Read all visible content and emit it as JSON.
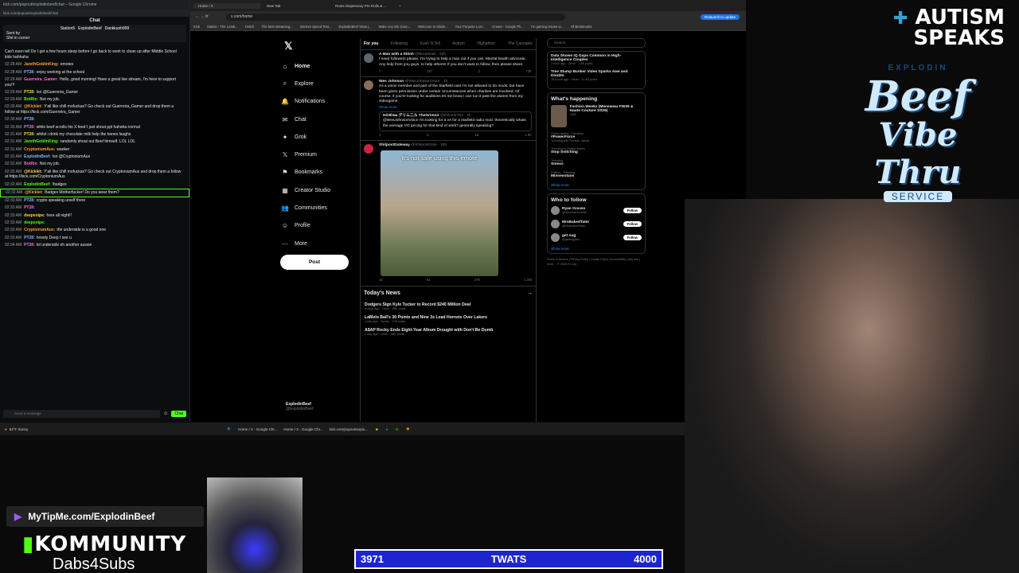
{
  "chat_window": {
    "title_bar": "kick.com/popout/explodinbeef/chat – Google Chrome",
    "url": "kick.com/popout/explodinbeef/chat",
    "chat_title": "Chat",
    "pinned": {
      "users": [
        "Station5",
        "ExplodinBeef",
        "Dankkush999"
      ],
      "sent_by": "Sent by",
      "text": "Shit in corner"
    },
    "messages": [
      {
        "time": "",
        "user": "",
        "text": "Can't even tell Do I get a few hours sleep before I go back to work to clean up after Middle School kids hahhaha"
      },
      {
        "time": "02:28 AM",
        "user": "JarethGoblinKing:",
        "text": "emotes"
      },
      {
        "time": "02:28 AM",
        "user": "PT28:",
        "text": "enjoy working at the school"
      },
      {
        "time": "02:29 AM",
        "user": "Guerreira_Gamer:",
        "text": "Hello, good morning! Have a great live stream, I'm here to support you!!!"
      },
      {
        "time": "02:29 AM",
        "user": "PT28:",
        "text": "Iso @Guerreira_Gamer"
      },
      {
        "time": "02:29 AM",
        "user": "BotRix:",
        "text": "Not my job."
      },
      {
        "time": "02:29 AM",
        "user": "@Kicklet:",
        "text": "Y'all like chill mofuckas? Go check out Guerreira_Gamer and drop them a follow at https://kick.com/Guerreira_Gamer"
      },
      {
        "time": "02:30 AM",
        "user": "PT28:",
        "text": ""
      },
      {
        "time": "02:30 AM",
        "user": "PT28:",
        "text": "while beef scrolls his X feed I just shout ppl hahaha normal"
      },
      {
        "time": "02:31 AM",
        "user": "PT28:",
        "text": "whilst i drink my chocolate milk help the bones laughs"
      },
      {
        "time": "02:31 AM",
        "user": "JarethGoblinKing:",
        "text": "randomly shout out Beef himself. LOL LOL"
      },
      {
        "time": "02:31 AM",
        "user": "CryptoniumAus:",
        "text": "wanker"
      },
      {
        "time": "02:31 AM",
        "user": "ExplodinBeef:",
        "text": "Iso @CryptoniumAus"
      },
      {
        "time": "02:32 AM",
        "user": "BotRix:",
        "text": "Not my job."
      },
      {
        "time": "02:32 AM",
        "user": "@Kicklet:",
        "text": "Y'all like chill mofuckas? Go check out CryptoniumAus and drop them a follow at https://kick.com/CryptoniumAus"
      },
      {
        "time": "02:32 AM",
        "user": "ExplodinBeef:",
        "text": "!badges"
      },
      {
        "time": "02:32 AM",
        "user": "@Kicklet:",
        "text": "Badges Motherfucker! Do you wear them?"
      },
      {
        "time": "02:33 AM",
        "user": "PT28:",
        "text": "crypto speaking urself there"
      },
      {
        "time": "02:33 AM",
        "user": "PT28:",
        "text": ""
      },
      {
        "time": "02:33 AM",
        "user": "deepsnipe:",
        "text": "here all night!!"
      },
      {
        "time": "02:33 AM",
        "user": "deepsnipe:",
        "text": ""
      },
      {
        "time": "02:33 AM",
        "user": "CryptoniumAus:",
        "text": "the underside is a good one"
      },
      {
        "time": "02:33 AM",
        "user": "PT28:",
        "text": "howdy Deep I see u"
      },
      {
        "time": "02:34 AM",
        "user": "PT28:",
        "text": "lol underside eh another aussie"
      }
    ],
    "input_placeholder": "Send a message",
    "chat_button": "Chat"
  },
  "x_browser": {
    "tabs": [
      "Home / X",
      "New Tab",
      "Roots Dispensary Pre Rolls & ..."
    ],
    "url": "x.com/home",
    "relaunch": "Relaunch to update",
    "bookmarks": [
      "Kick",
      "Statsio - The Leadi...",
      "Twitch",
      "The best streaming...",
      "Internet Speed Test...",
      "ExplodinBeef Stats |...",
      "Make Any Mic Soun...",
      "Welcome to Glidin...",
      "Your Purpose Lost...",
      "Create - Google Ph...",
      "I'm gaming issues w...",
      "All Bookmarks"
    ],
    "nav": [
      "Home",
      "Explore",
      "Notifications",
      "Chat",
      "Grok",
      "Premium",
      "Bookmarks",
      "Creator Studio",
      "Communities",
      "Profile",
      "More"
    ],
    "post_button": "Post",
    "account": {
      "name": "ExplodinBeef",
      "handle": "@ExplodinBeef"
    },
    "feed_tabs": [
      "For you",
      "Following",
      "Kush N Tell",
      "Autism",
      "Highathon",
      "The Cannabis"
    ],
    "tweets": [
      {
        "name": "A Man with a Stitch",
        "handle": "@Broadcast · 23h",
        "text": "I need followers please, I'm trying to help a man out if you can. Mental health advocate. Any help from you guys, to help others!! If you don't want to follow, then please share.",
        "stats": [
          "7",
          "127",
          "4",
          "73K"
        ]
      },
      {
        "name": "Wes Johnson",
        "handle": "@WesJohnsonVoice · 4h",
        "text": "As a union member and part of the Starfield cast I'm not allowed to do mods, but have been given permission under certain circumstances when charities are involved. Of course, if you're looking for auditions let me know I can run it past the alumni from my videogame",
        "show_more": "Show more",
        "quote_name": "Hỏ3ℓ3𝓂 グリム二ル TheGrimnir",
        "quote_handle": "@GrimnirThe · 7h",
        "quote_text": "@WesJohnsonVoice I'm looking for a vA for a starfield radio mod. theoretically whats the average VO pricing for that kind of work? generally speaking?",
        "stats": [
          "1",
          "5",
          "16",
          "1.6K"
        ]
      },
      {
        "name": "ShitpostGateway",
        "handle": "@ShitpostGate · 15h",
        "video_caption": "It's not safe using this emote",
        "stats": [
          "15",
          "61",
          "37K",
          "1.2M"
        ]
      }
    ],
    "todays_news": {
      "title": "Today's News",
      "items": [
        {
          "title": "Dodgers Sign Kyle Tucker to Record $240 Million Deal",
          "sub": "3 days ago · Other · 85K posts"
        },
        {
          "title": "LaMelo Ball's 30 Points and Nine 3s Lead Hornets Over Lakers",
          "sub": "1 day ago · Sports · 12K posts"
        },
        {
          "title": "A$AP Rocky Ends Eight-Year Album Drought with Don't Be Dumb",
          "sub": "1 day ago · Other · 46K posts"
        }
      ]
    },
    "search_placeholder": "Search",
    "top_trends": [
      {
        "title": "Data Shows IQ Gaps Common in High-Intelligence Couples",
        "sub": "1 hour ago · Other · 2.5K posts"
      },
      {
        "title": "Tree Stump Bunker Video Sparks Awe and Doubts",
        "sub": "15 hours ago · Other · 11.4K posts"
      }
    ],
    "whats_happening": {
      "title": "What's happening",
      "featured": {
        "title": "Fashion Weeks (Menswear FW26 & Haute Couture SS26)",
        "sub": "LIVE"
      },
      "trends": [
        {
          "context": "Online dating · Trending",
          "title": "#PowerForce",
          "sub": "Trending with Tamsin, Jamal"
        },
        {
          "context": "Trending in United States",
          "title": "Stop Snitching",
          "sub": ""
        },
        {
          "context": "Trending",
          "title": "Smeos",
          "sub": ""
        },
        {
          "context": "Politics · Trending",
          "title": "Minnesotans",
          "sub": ""
        }
      ],
      "show_more": "Show more"
    },
    "who_to_follow": {
      "title": "Who to follow",
      "people": [
        {
          "name": "Ryan Graves",
          "handle": "@uncertainhuman"
        },
        {
          "name": "MrsBakedTater",
          "handle": "@MrsBakedTater"
        },
        {
          "name": "get nug",
          "handle": "@gotnugdao"
        }
      ],
      "follow_label": "Follow",
      "show_more": "Show more"
    },
    "footer": "Terms of Service | Privacy Policy | Cookie Policy | Accessibility | Ads info | More ... © 2026 X Corp."
  },
  "taskbar": {
    "weather_temp": "54°F",
    "weather_desc": "Sunny",
    "items": [
      "Home / X - Google Chr...",
      "Home / X - Google Chr...",
      "kick.com/popout/explo..."
    ]
  },
  "overlays": {
    "autism_speaks": [
      "AUTISM",
      "SPEAKS"
    ],
    "logo": {
      "line1": "EXPLODIN",
      "line2": "Beef",
      "line3": "Vibe Thru",
      "line4": "SERVICE"
    },
    "tipme": "MyTipMe.com/ExplodinBeef",
    "community": "KOMMUNITY",
    "dabs": "Dabs4Subs",
    "goal": {
      "current": "3971",
      "label": "TWATS",
      "target": "4000"
    }
  },
  "colors": {
    "kick_green": "#53fc18",
    "x_blue": "#1d9bf0",
    "goal_bar": "#1e24d0"
  }
}
